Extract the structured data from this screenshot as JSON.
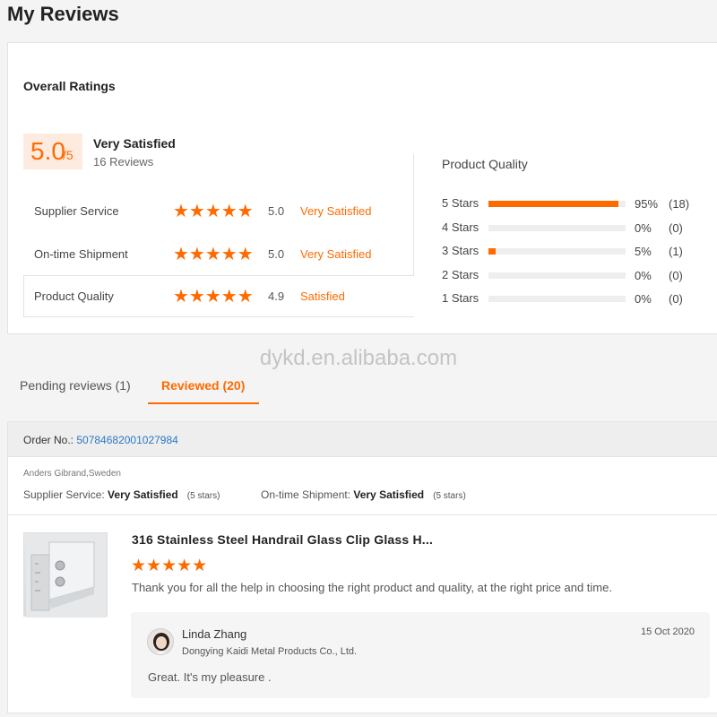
{
  "page_title": "My Reviews",
  "overall": {
    "title": "Overall Ratings",
    "score": "5.0",
    "score_suffix": "/5",
    "satisfaction": "Very Satisfied",
    "review_count": "16 Reviews",
    "stars_glyph": "★★★★★",
    "rows": [
      {
        "label": "Supplier Service",
        "score": "5.0",
        "text": "Very Satisfied",
        "stars": 5
      },
      {
        "label": "On-time Shipment",
        "score": "5.0",
        "text": "Very Satisfied",
        "stars": 5
      },
      {
        "label": "Product Quality",
        "score": "4.9",
        "text": "Satisfied",
        "stars": 5
      }
    ]
  },
  "product_quality": {
    "title": "Product Quality",
    "accent": "#ff6a00",
    "distribution": [
      {
        "label": "5  Stars",
        "percent_text": "95%",
        "count": "(18)",
        "fill": 0.95
      },
      {
        "label": "4  Stars",
        "percent_text": "0%",
        "count": "(0)",
        "fill": 0
      },
      {
        "label": "3  Stars",
        "percent_text": "5%",
        "count": "(1)",
        "fill": 0.05
      },
      {
        "label": "2  Stars",
        "percent_text": "0%",
        "count": "(0)",
        "fill": 0
      },
      {
        "label": "1  Stars",
        "percent_text": "0%",
        "count": "(0)",
        "fill": 0
      }
    ]
  },
  "watermark": "dykd.en.alibaba.com",
  "tabs": [
    {
      "label": "Pending reviews (1)",
      "active": false
    },
    {
      "label": "Reviewed (20)",
      "active": true
    }
  ],
  "review": {
    "order_label": "Order No.: ",
    "order_number": "50784682001027984",
    "buyer": "Anders Gibrand,Sweden",
    "supplier_service_label": "Supplier Service: ",
    "supplier_service_value": "Very Satisfied",
    "supplier_service_stars": "(5 stars)",
    "shipment_label": "On-time Shipment: ",
    "shipment_value": "Very Satisfied",
    "shipment_stars": "(5 stars)",
    "product_title": "316 Stainless Steel Handrail Glass Clip Glass H...",
    "product_stars": "★★★★★",
    "text": "Thank you for all the help in choosing the right product and quality, at the right price and time.",
    "reply": {
      "name": "Linda Zhang",
      "company": "Dongying Kaidi Metal Products Co., Ltd.",
      "date": "15 Oct 2020",
      "text": "Great. It's my pleasure ."
    }
  }
}
